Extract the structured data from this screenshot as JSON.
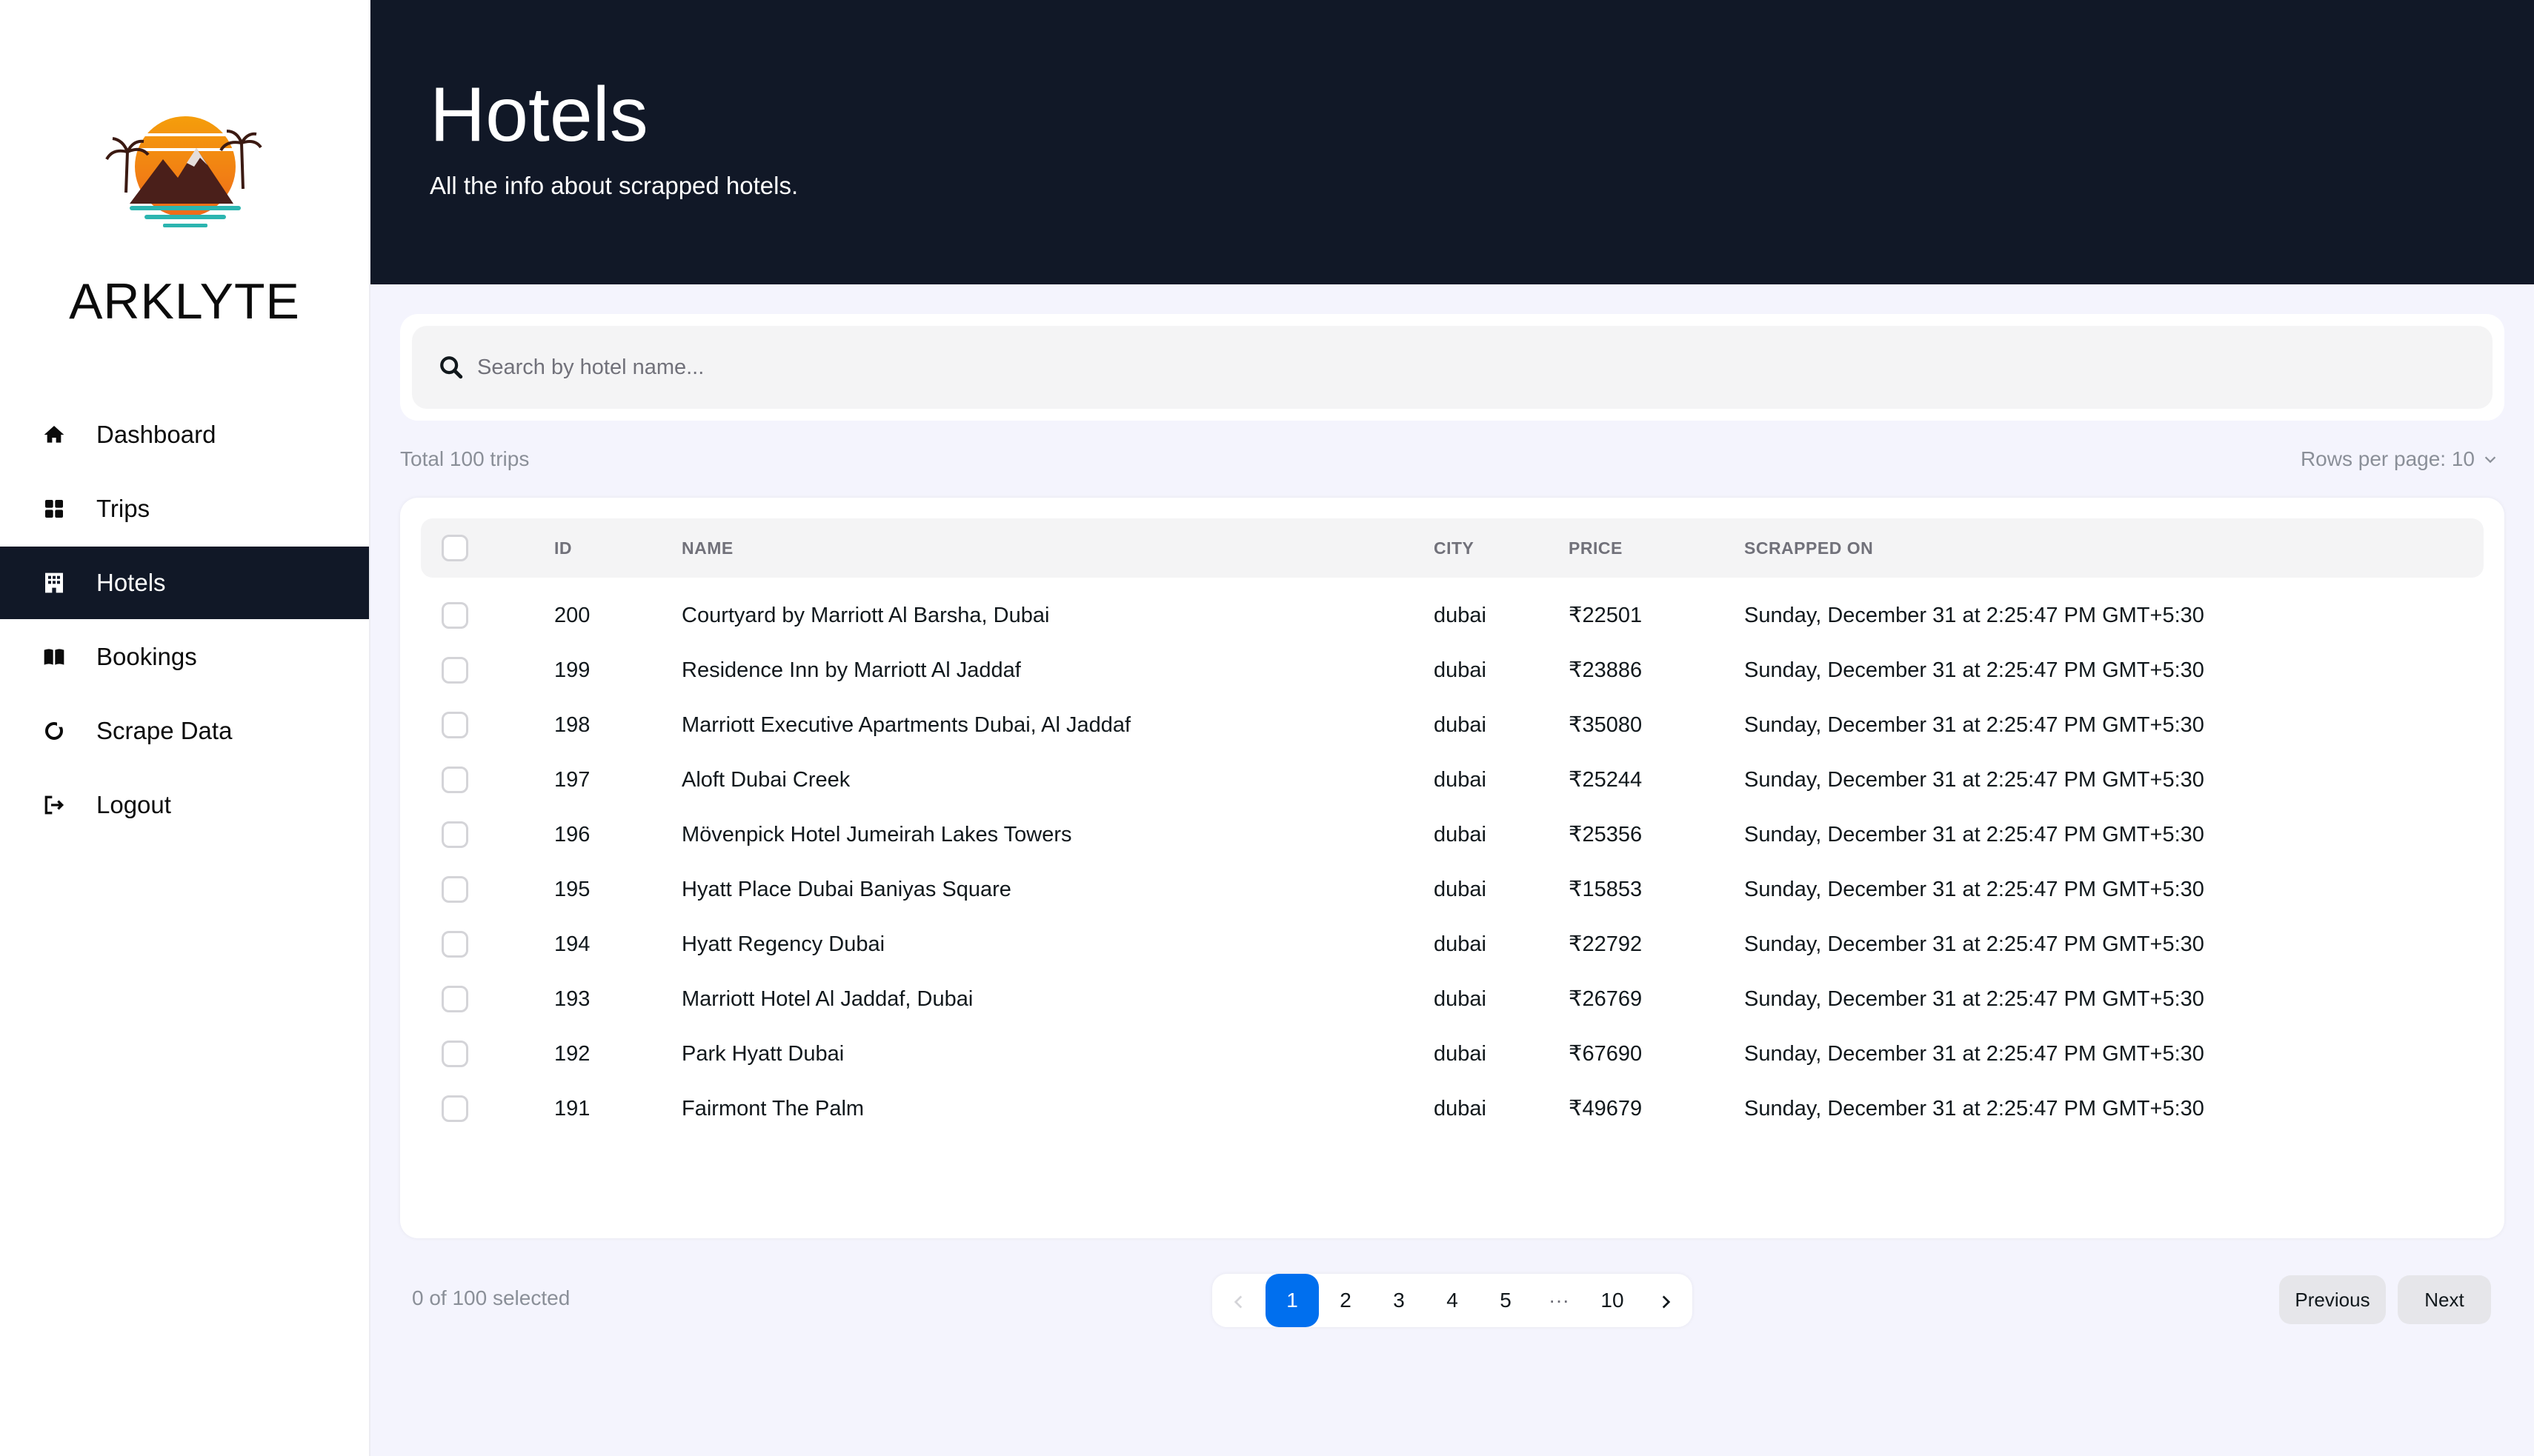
{
  "app": {
    "brand": "ARKLYTE"
  },
  "sidebar": {
    "items": [
      {
        "label": "Dashboard",
        "icon": "home-icon",
        "active": false
      },
      {
        "label": "Trips",
        "icon": "grid-icon",
        "active": false
      },
      {
        "label": "Hotels",
        "icon": "building-icon",
        "active": true
      },
      {
        "label": "Bookings",
        "icon": "book-icon",
        "active": false
      },
      {
        "label": "Scrape Data",
        "icon": "circle-icon",
        "active": false
      },
      {
        "label": "Logout",
        "icon": "logout-icon",
        "active": false
      }
    ]
  },
  "header": {
    "title": "Hotels",
    "subtitle": "All the info about scrapped hotels."
  },
  "search": {
    "placeholder": "Search by hotel name...",
    "value": ""
  },
  "summary": {
    "total": "Total 100 trips",
    "rows_per_page": "Rows per page: 10"
  },
  "table": {
    "columns": [
      "ID",
      "NAME",
      "CITY",
      "PRICE",
      "SCRAPPED ON"
    ],
    "rows": [
      {
        "id": "200",
        "name": "Courtyard by Marriott Al Barsha, Dubai",
        "city": "dubai",
        "price": "₹22501",
        "scrapped_on": "Sunday, December 31 at 2:25:47 PM GMT+5:30"
      },
      {
        "id": "199",
        "name": "Residence Inn by Marriott Al Jaddaf",
        "city": "dubai",
        "price": "₹23886",
        "scrapped_on": "Sunday, December 31 at 2:25:47 PM GMT+5:30"
      },
      {
        "id": "198",
        "name": "Marriott Executive Apartments Dubai, Al Jaddaf",
        "city": "dubai",
        "price": "₹35080",
        "scrapped_on": "Sunday, December 31 at 2:25:47 PM GMT+5:30"
      },
      {
        "id": "197",
        "name": "Aloft Dubai Creek",
        "city": "dubai",
        "price": "₹25244",
        "scrapped_on": "Sunday, December 31 at 2:25:47 PM GMT+5:30"
      },
      {
        "id": "196",
        "name": "Mövenpick Hotel Jumeirah Lakes Towers",
        "city": "dubai",
        "price": "₹25356",
        "scrapped_on": "Sunday, December 31 at 2:25:47 PM GMT+5:30"
      },
      {
        "id": "195",
        "name": "Hyatt Place Dubai Baniyas Square",
        "city": "dubai",
        "price": "₹15853",
        "scrapped_on": "Sunday, December 31 at 2:25:47 PM GMT+5:30"
      },
      {
        "id": "194",
        "name": "Hyatt Regency Dubai",
        "city": "dubai",
        "price": "₹22792",
        "scrapped_on": "Sunday, December 31 at 2:25:47 PM GMT+5:30"
      },
      {
        "id": "193",
        "name": "Marriott Hotel Al Jaddaf, Dubai",
        "city": "dubai",
        "price": "₹26769",
        "scrapped_on": "Sunday, December 31 at 2:25:47 PM GMT+5:30"
      },
      {
        "id": "192",
        "name": "Park Hyatt Dubai",
        "city": "dubai",
        "price": "₹67690",
        "scrapped_on": "Sunday, December 31 at 2:25:47 PM GMT+5:30"
      },
      {
        "id": "191",
        "name": "Fairmont The Palm",
        "city": "dubai",
        "price": "₹49679",
        "scrapped_on": "Sunday, December 31 at 2:25:47 PM GMT+5:30"
      }
    ]
  },
  "footer": {
    "selected": "0 of 100 selected",
    "pages": [
      "1",
      "2",
      "3",
      "4",
      "5",
      "···",
      "10"
    ],
    "current_page": "1",
    "previous_label": "Previous",
    "next_label": "Next"
  },
  "colors": {
    "header_bg": "#111827",
    "accent": "#006fee",
    "page_bg": "#f4f4fd"
  }
}
